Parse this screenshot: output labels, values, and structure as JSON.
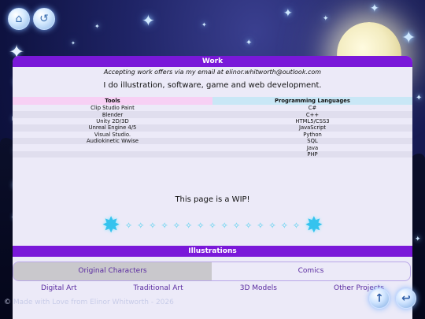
{
  "colors": {
    "accent": "#7a18d9",
    "tab_active": "#c9c8cc",
    "tools_header": "#f7d0f4",
    "langs_header": "#c9e7f6",
    "ornament": "#35c3ee"
  },
  "top_buttons": {
    "home_icon": "home-icon",
    "back_icon": "back-icon"
  },
  "side_nav": [
    "star-icon",
    "link-icon",
    "chat-icon",
    "heart-icon",
    "mail-icon",
    "star-icon"
  ],
  "work": {
    "title": "Work",
    "offer": "Accepting work offers via my email at elinor.whitworth@outlook.com",
    "intro": "I do illustration, software, game and web development."
  },
  "skills": {
    "headers": {
      "tools": "Tools",
      "langs": "Programming Languages"
    },
    "rows": [
      {
        "tool": "Clip Studio Paint",
        "lang": "C#"
      },
      {
        "tool": "Blender",
        "lang": "C++"
      },
      {
        "tool": "Unity 2D/3D",
        "lang": "HTML5/CSS3"
      },
      {
        "tool": "Unreal Engine 4/5",
        "lang": "JavaScript"
      },
      {
        "tool": "Visual Studio.",
        "lang": "Python"
      },
      {
        "tool": "Audiokinetic Wwise",
        "lang": "SQL"
      },
      {
        "tool": "",
        "lang": "Java"
      },
      {
        "tool": "",
        "lang": "PHP"
      }
    ]
  },
  "wip": "This page is a WIP!",
  "illustrations": {
    "title": "Illustrations",
    "tabs": [
      "Original Characters",
      "Comics"
    ],
    "subtabs": [
      "Digital Art",
      "Traditional Art",
      "3D Models",
      "Other Projects"
    ]
  },
  "footer": "© Made with Love from Elinor Whitworth - 2026",
  "fabs": {
    "up_icon": "arrow-up-icon",
    "back_icon": "return-icon"
  }
}
